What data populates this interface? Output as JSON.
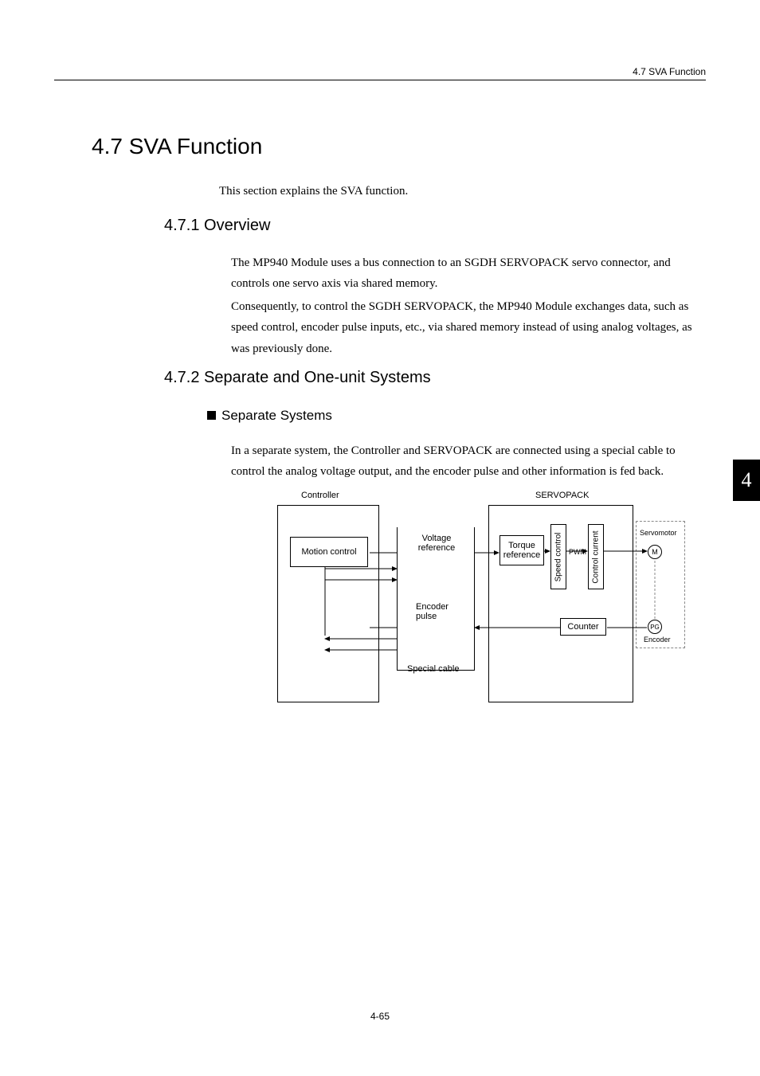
{
  "header": {
    "right_text": "4.7  SVA Function"
  },
  "section": {
    "title": "4.7  SVA Function",
    "intro": "This section explains the SVA function."
  },
  "sub1": {
    "title": "4.7.1  Overview",
    "p1": "The MP940 Module uses a bus connection to an SGDH SERVOPACK servo connector, and controls one servo axis via shared memory.",
    "p2": "Consequently, to control the SGDH SERVOPACK, the MP940 Module exchanges data, such as speed control, encoder pulse inputs, etc., via shared memory instead of using analog voltages, as was previously done."
  },
  "sub2": {
    "title": "4.7.2  Separate and One-unit Systems",
    "h3": "Separate Systems",
    "p3": "In a separate system, the Controller and SERVOPACK are connected using a special cable to control the analog voltage output, and the encoder pulse and other information is fed back."
  },
  "chapter_tab": "4",
  "diagram": {
    "controller": "Controller",
    "servopack": "SERVOPACK",
    "motion_control": "Motion control",
    "voltage_reference": "Voltage\nreference",
    "torque_reference": "Torque\nreference",
    "speed_control": "Speed control",
    "control_current": "Control current",
    "pwm": "PWM",
    "counter": "Counter",
    "encoder_pulse": "Encoder\npulse",
    "special_cable": "Special cable",
    "servomotor": "Servomotor",
    "m": "M",
    "pg": "PG",
    "encoder": "Encoder"
  },
  "footer": {
    "page": "4-65"
  }
}
